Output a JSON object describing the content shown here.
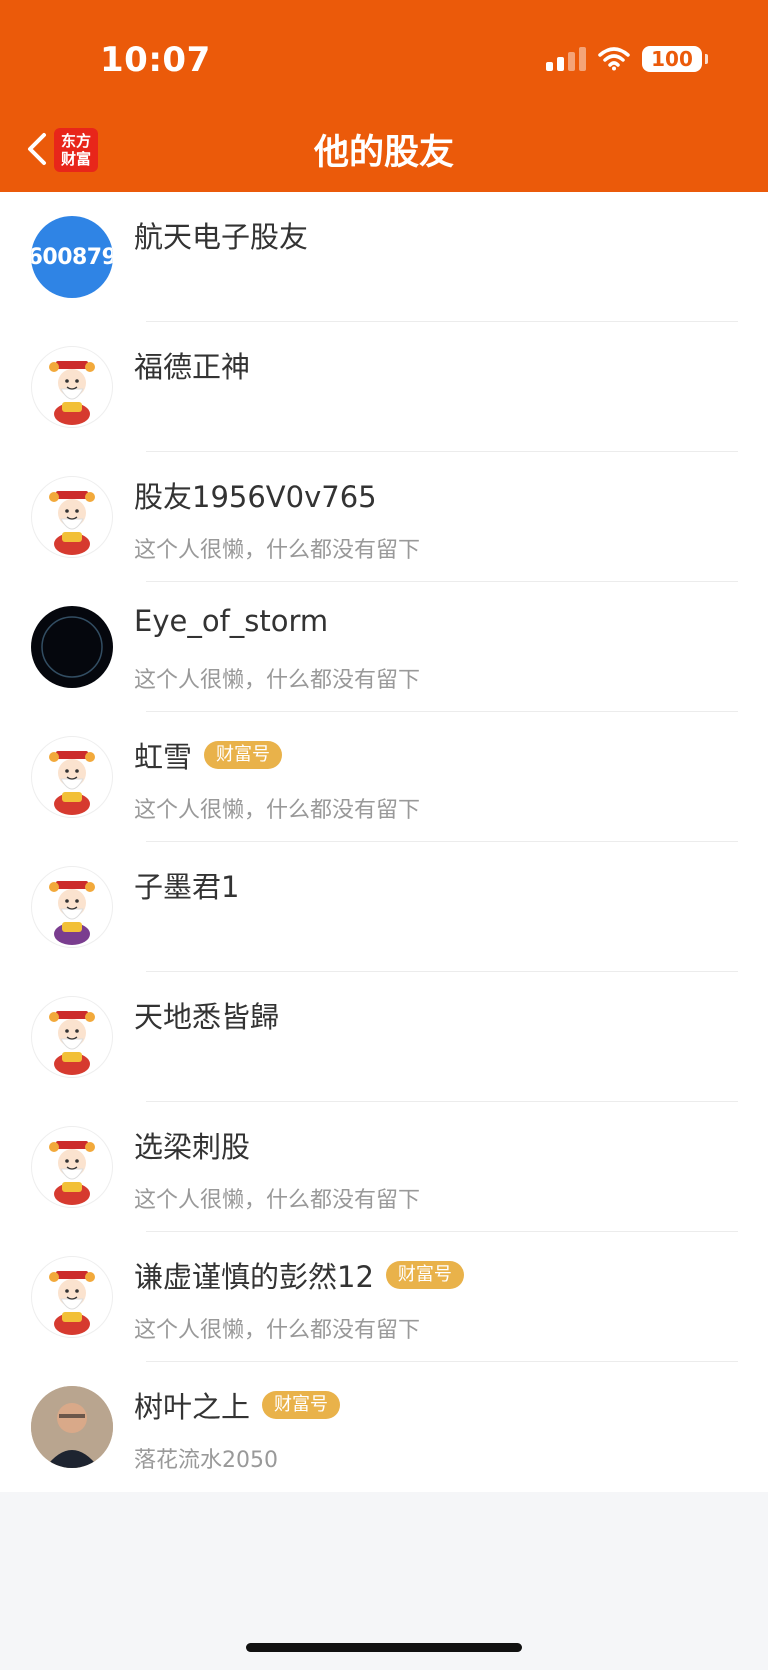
{
  "status_bar": {
    "time": "10:07",
    "battery": "100"
  },
  "nav": {
    "title": "他的股友",
    "logo_line1": "东方",
    "logo_line2": "财富"
  },
  "colors": {
    "header_bg": "#eb5a0a",
    "badge_bg": "#e9b24a",
    "stock_avatar_bg": "#2f84e5"
  },
  "friends": [
    {
      "name": "航天电子股友",
      "badge": "",
      "desc": "",
      "avatar": "stock",
      "avatar_text": "600879"
    },
    {
      "name": "福德正神",
      "badge": "",
      "desc": "",
      "avatar": "god-red"
    },
    {
      "name": "股友1956V0v765",
      "badge": "",
      "desc": "这个人很懒，什么都没有留下",
      "avatar": "god-red"
    },
    {
      "name": "Eye_of_storm",
      "badge": "",
      "desc": "这个人很懒，什么都没有留下",
      "avatar": "dark"
    },
    {
      "name": "虹雪",
      "badge": "财富号",
      "desc": "这个人很懒，什么都没有留下",
      "avatar": "god-red"
    },
    {
      "name": "子墨君1",
      "badge": "",
      "desc": "",
      "avatar": "god-purple"
    },
    {
      "name": "天地悉皆歸",
      "badge": "",
      "desc": "",
      "avatar": "god-red"
    },
    {
      "name": "选梁刺股",
      "badge": "",
      "desc": "这个人很懒，什么都没有留下",
      "avatar": "god-red"
    },
    {
      "name": "谦虚谨慎的彭然12",
      "badge": "财富号",
      "desc": "这个人很懒，什么都没有留下",
      "avatar": "god-red"
    },
    {
      "name": "树叶之上",
      "badge": "财富号",
      "desc": "落花流水2050",
      "avatar": "photo"
    }
  ]
}
